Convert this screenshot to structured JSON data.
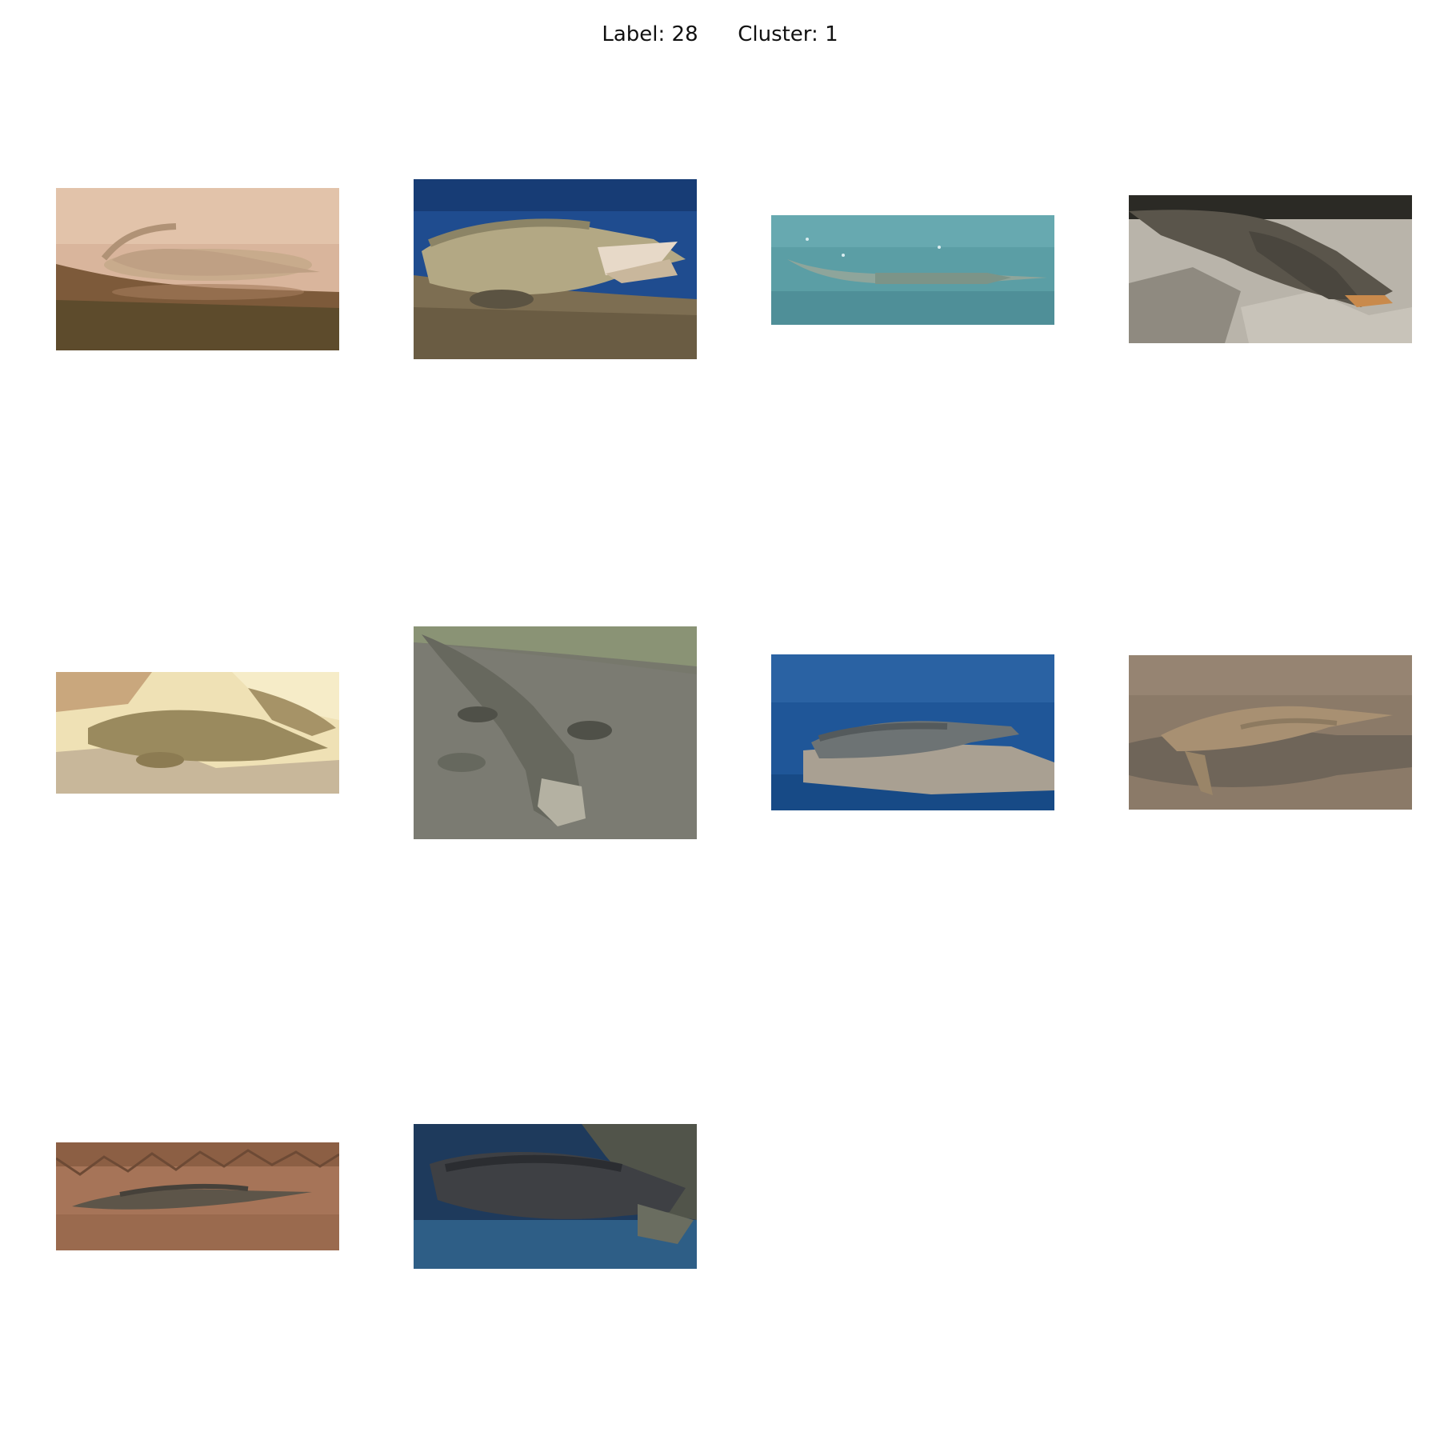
{
  "figure": {
    "title": "Label: 28      Cluster: 1"
  },
  "images": [
    {
      "description": "pale crocodile resting on sandy bank beside brown water"
    },
    {
      "description": "crocodile with open jaws on sand in front of blue water"
    },
    {
      "description": "long thin crocodile floating in turquoise water"
    },
    {
      "description": "dark crocodile on grey rocks with open mouth"
    },
    {
      "description": "crocodile basking on pale sunlit rocks"
    },
    {
      "description": "large crocodile on wet rock with mouth open"
    },
    {
      "description": "crocodile resting on a rock in blue water"
    },
    {
      "description": "crocodile lying on a log in muddy water"
    },
    {
      "description": "small dark crocodile on dry grass and dirt"
    },
    {
      "description": "dark crocodile on rocks beside water"
    }
  ]
}
